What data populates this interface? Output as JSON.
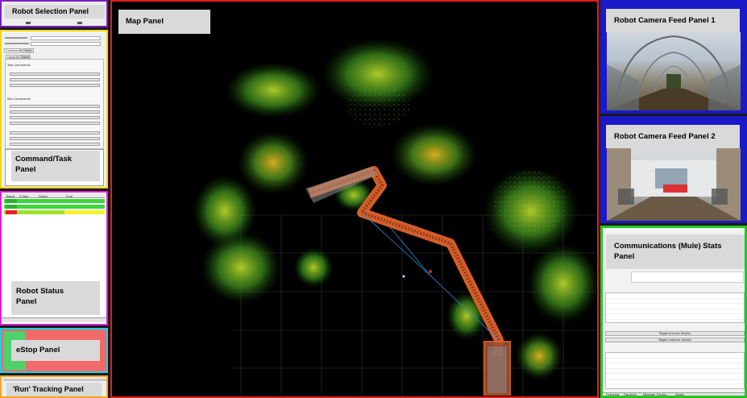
{
  "colors": {
    "selection_border": "#7b1fc4",
    "command_border": "#f2d600",
    "status_border": "#e01be0",
    "estop_border": "#19d0e6",
    "estop_fill": "#f06a6a",
    "estop_green": "#4fd06a",
    "tracking_border": "#f5a623",
    "map_border": "#e31b1b",
    "camera_border": "#1a1ac8",
    "comms_border": "#22c81e"
  },
  "labels": {
    "robot_selection": "Robot Selection Panel",
    "command_task": "Command/Task\nPanel",
    "robot_status": "Robot Status\nPanel",
    "estop": "eStop Panel",
    "run_tracking": "'Run' Tracking Panel",
    "map": "Map Panel",
    "camera1": "Robot Camera Feed Panel 1",
    "camera2": "Robot Camera Feed Panel 2",
    "comms": "Communications (Mule) Stats\nPanel"
  },
  "command_panel": {
    "tabs": [
      "Commands",
      "Tasks"
    ],
    "subtabs": [
      "Generic",
      "Drone"
    ],
    "section1": "Task Commands",
    "section1_buttons": [
      "Goto XY",
      "Task Allocation",
      "Sync Content"
    ],
    "section2": "Misc Commands",
    "section2_buttons": [
      "Drop Node",
      "Auto Launch",
      "Update",
      "Unstick"
    ],
    "section3_buttons": [
      "Send Cfg",
      "Stop",
      "Clear Cmd"
    ]
  },
  "status_panel": {
    "headers": [
      "Robot",
      "E-Stop",
      "Status",
      "Error"
    ]
  },
  "comms_panel": {
    "toggle1": "Toggle process display",
    "toggle2": "Toggle progress display",
    "tabs": [
      "Overview",
      "Transfers",
      "Message Tracker",
      "Nodes"
    ]
  }
}
